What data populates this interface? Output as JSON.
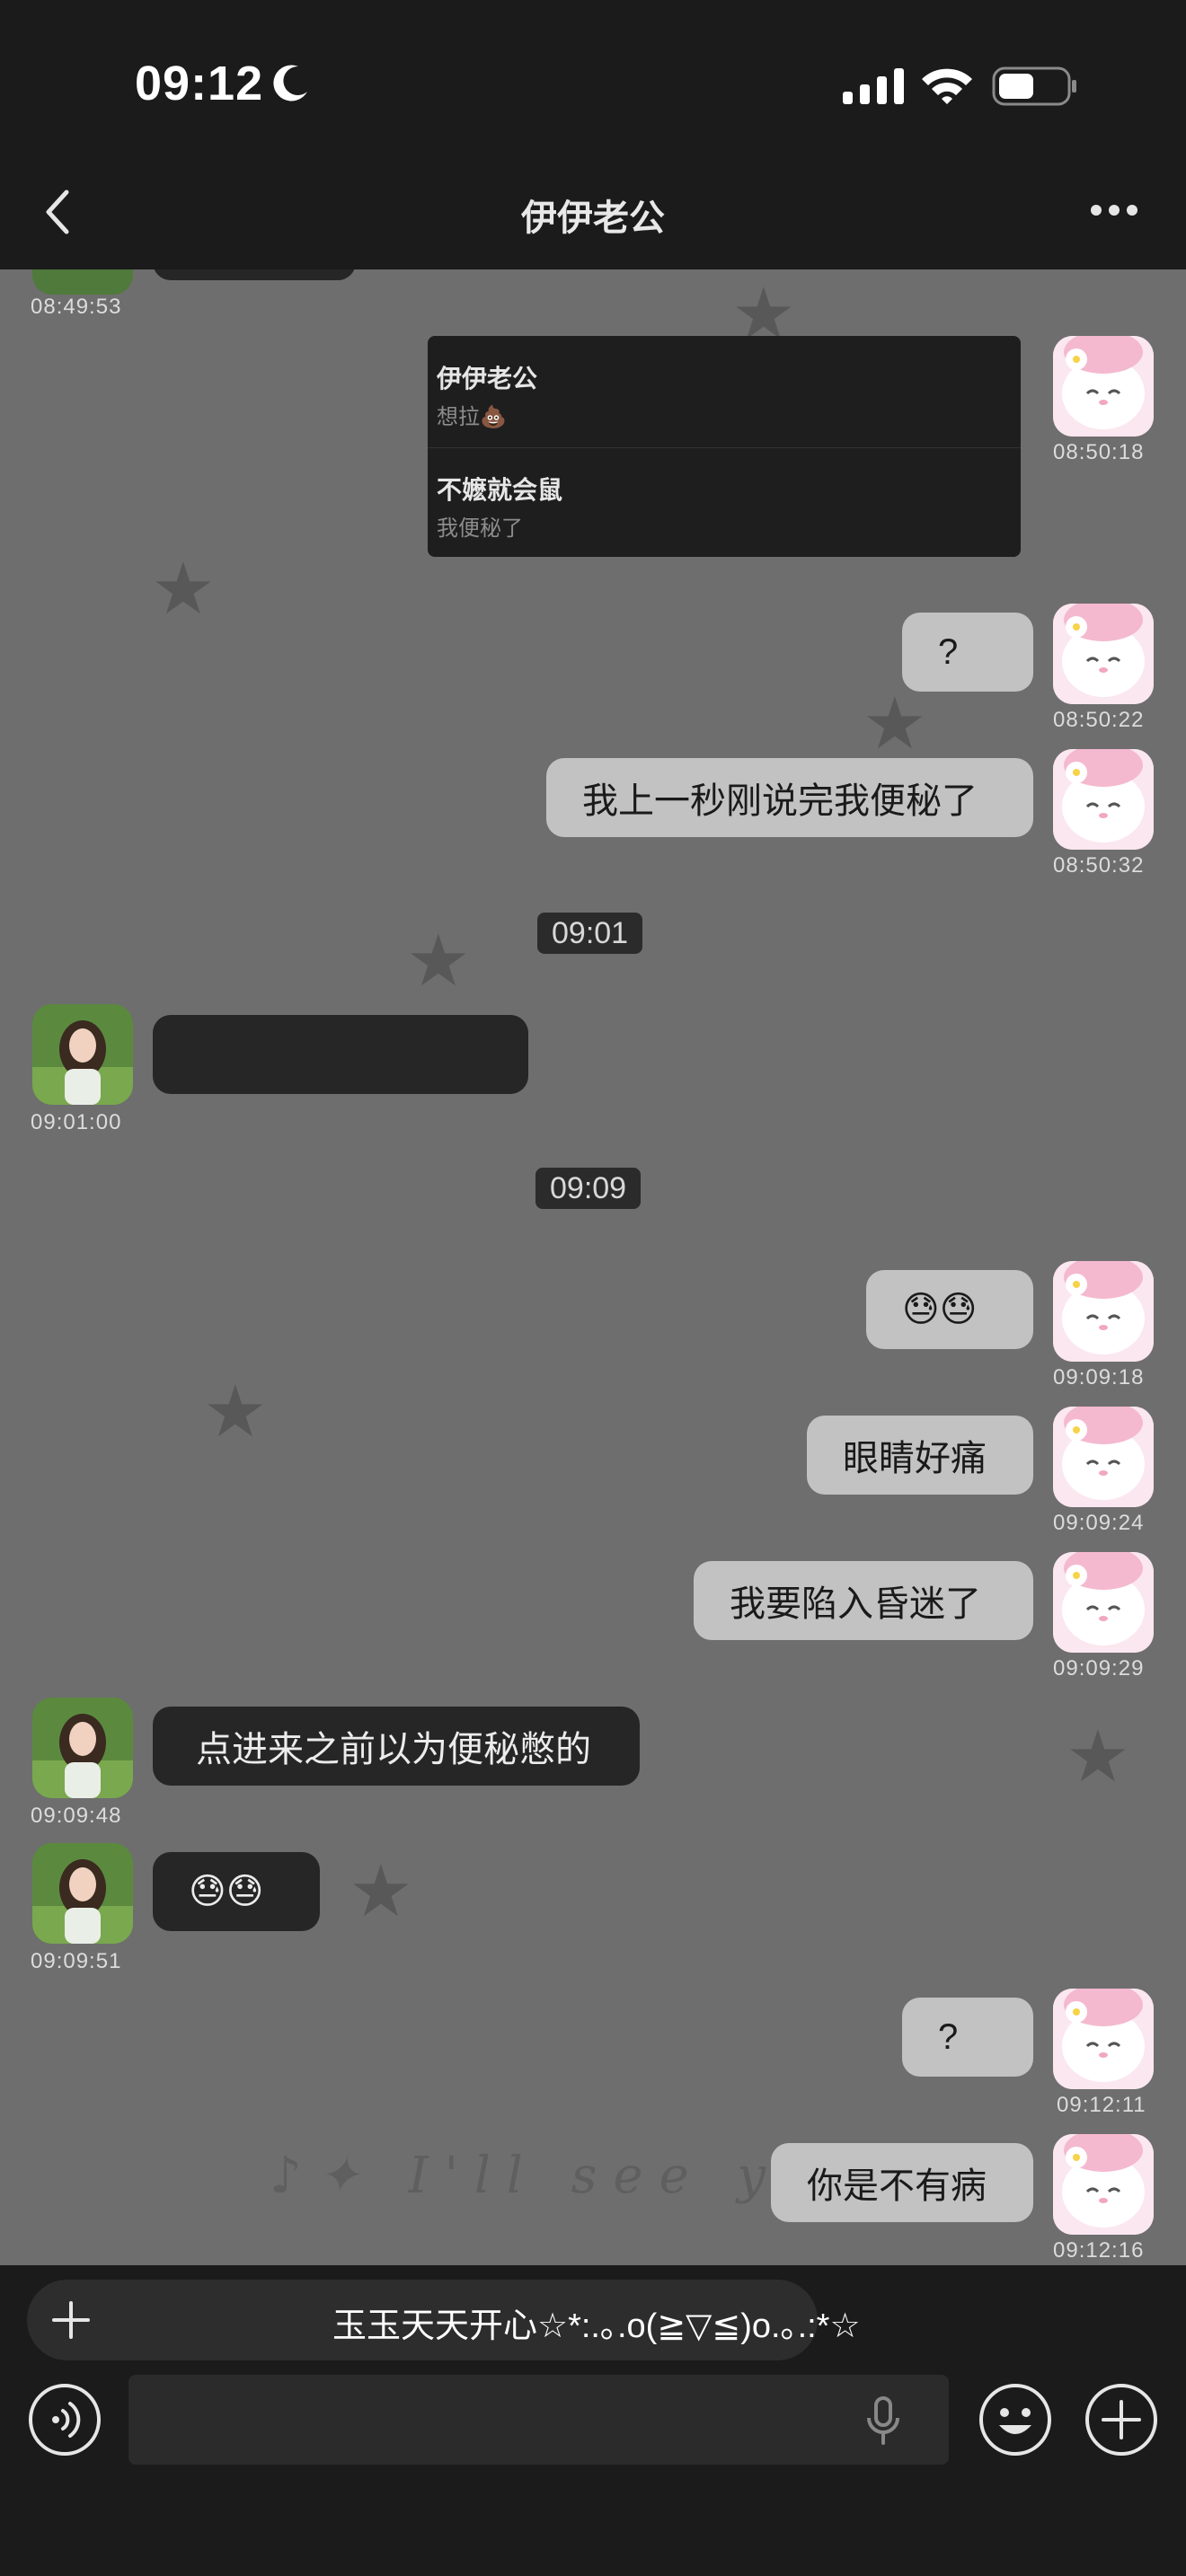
{
  "status_bar": {
    "time": "09:12"
  },
  "nav": {
    "title": "伊伊老公"
  },
  "chat": {
    "top_partial_timestamp": "08:49:53",
    "quote": {
      "items": [
        {
          "name": "伊伊老公",
          "message": "想拉💩"
        },
        {
          "name": "不嬷就会鼠",
          "message": "我便秘了"
        }
      ],
      "timestamp": "08:50:18"
    },
    "msg_1": {
      "text": "?",
      "timestamp": "08:50:22"
    },
    "msg_2": {
      "text": "我上一秒刚说完我便秘了",
      "timestamp": "08:50:32"
    },
    "sep_1": "09:01",
    "msg_3": {
      "text": "",
      "timestamp": "09:01:00"
    },
    "sep_2": "09:09",
    "msg_4": {
      "text": "😓😓",
      "timestamp": "09:09:18"
    },
    "msg_5": {
      "text": "眼睛好痛",
      "timestamp": "09:09:24"
    },
    "msg_6": {
      "text": "我要陷入昏迷了",
      "timestamp": "09:09:29"
    },
    "msg_7": {
      "text": "点进来之前以为便秘憋的",
      "timestamp": "09:09:48"
    },
    "msg_8": {
      "text": "😓😓",
      "timestamp": "09:09:51"
    },
    "msg_9": {
      "text": "?",
      "timestamp": "09:12:11"
    },
    "msg_10": {
      "text": "你是不有病",
      "timestamp": "09:12:16"
    },
    "background_text": "♪✦ I'll see you"
  },
  "bottom": {
    "banner_text": "玉玉天天开心☆*:.｡.o(≧▽≦)o.｡.:*☆"
  }
}
